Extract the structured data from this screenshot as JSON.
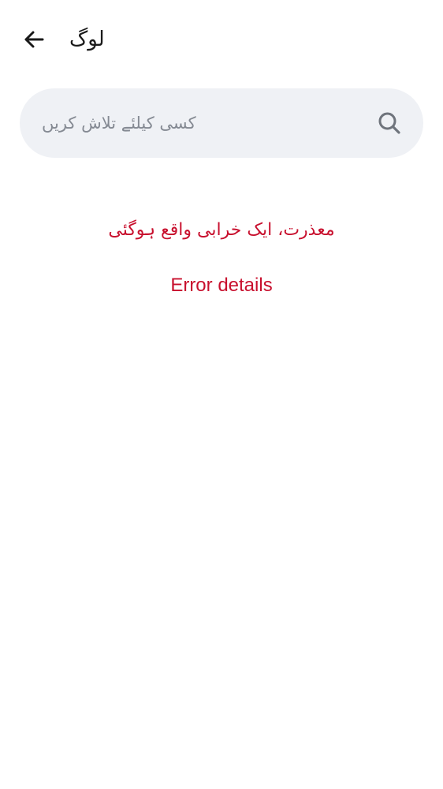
{
  "header": {
    "title": "لوگ",
    "back_icon": "arrow-left-icon"
  },
  "search": {
    "placeholder": "کسی کیلئے تلاش کریں",
    "value": "",
    "icon": "search-icon"
  },
  "error": {
    "message": "معذرت، ایک خرابی واقع ہوگئی",
    "details_link": "Error details",
    "color": "#c8102e"
  },
  "colors": {
    "background": "#ffffff",
    "search_background": "#eff1f5",
    "text_primary": "#1a1a1a",
    "placeholder": "#858a93"
  }
}
